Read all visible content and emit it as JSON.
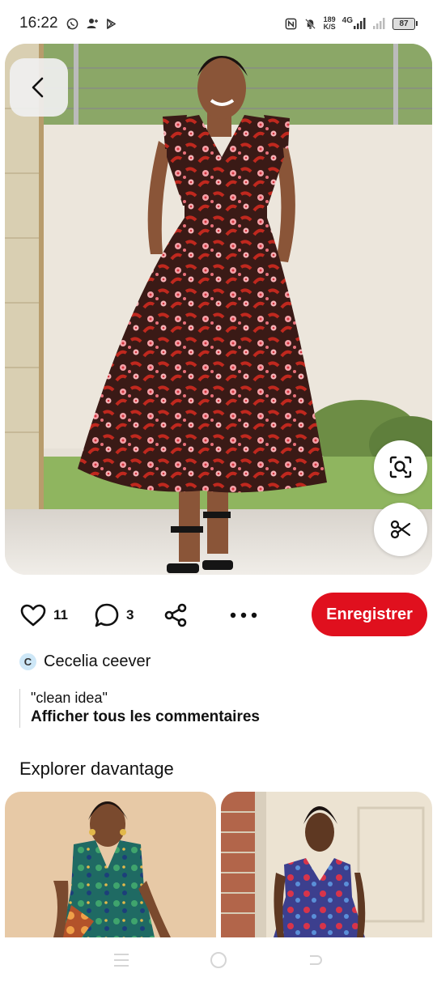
{
  "status_bar": {
    "time": "16:22",
    "net_speed_value": "189",
    "net_speed_unit": "K/S",
    "network_type": "4G",
    "battery": "87"
  },
  "pin": {
    "like_count": "11",
    "comment_count": "3",
    "save_label": "Enregistrer",
    "author_initial": "C",
    "author_name": "Cecelia ceever",
    "comment_text": "\"clean idea\"",
    "all_comments_label": "Afficher tous les commentaires"
  },
  "explore": {
    "title": "Explorer davantage"
  },
  "colors": {
    "accent": "#e0101e"
  },
  "icons": {
    "back": "chevron-left-icon",
    "lens": "visual-search-icon",
    "cut": "scissors-icon",
    "like": "heart-icon",
    "comment": "comment-bubble-icon",
    "share": "share-icon",
    "more": "more-horizontal-icon"
  }
}
